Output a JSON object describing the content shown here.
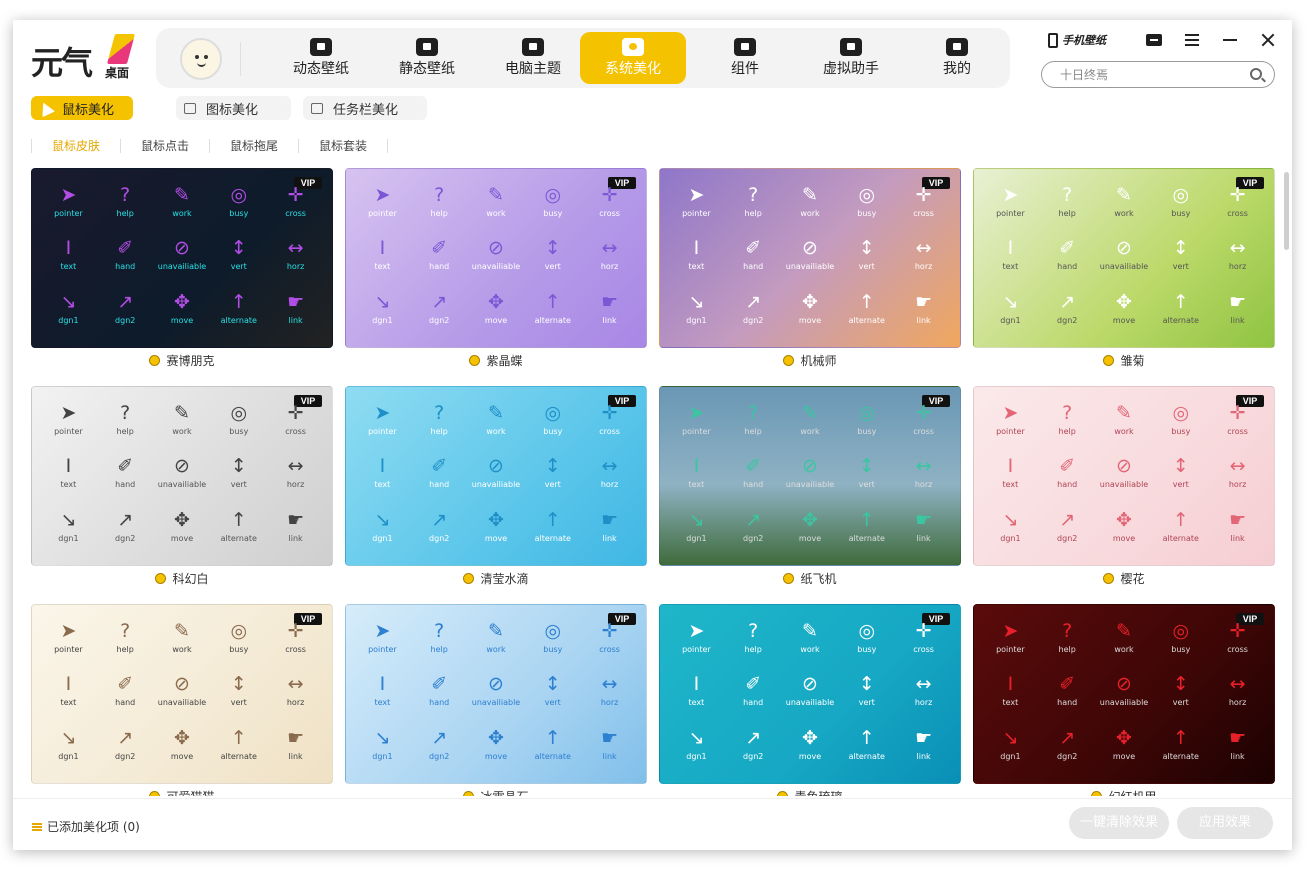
{
  "app": {
    "logo_text": "元气",
    "logo_sub": "桌面"
  },
  "nav": {
    "items": [
      {
        "label": "动态壁纸",
        "icon": "tv-icon"
      },
      {
        "label": "静态壁纸",
        "icon": "picture-icon"
      },
      {
        "label": "电脑主题",
        "icon": "shirt-icon"
      },
      {
        "label": "系统美化",
        "icon": "flower-icon",
        "active": true
      },
      {
        "label": "组件",
        "icon": "widget-icon"
      },
      {
        "label": "虚拟助手",
        "icon": "paw-icon"
      },
      {
        "label": "我的",
        "icon": "face-icon"
      }
    ]
  },
  "header": {
    "phone_wallpaper": "手机壁纸",
    "search_placeholder": "十日终焉"
  },
  "subtabs": [
    {
      "label": "鼠标美化",
      "active": true
    },
    {
      "label": "图标美化"
    },
    {
      "label": "任务栏美化"
    }
  ],
  "filters": [
    {
      "label": "鼠标皮肤",
      "active": true
    },
    {
      "label": "鼠标点击"
    },
    {
      "label": "鼠标拖尾"
    },
    {
      "label": "鼠标套装"
    }
  ],
  "cursor_labels": [
    "pointer",
    "help",
    "work",
    "busy",
    "cross",
    "text",
    "hand",
    "unavailiable",
    "vert",
    "horz",
    "dgn1",
    "dgn2",
    "move",
    "alternate",
    "link"
  ],
  "vip_label": "VIP",
  "cards": [
    {
      "name": "赛博朋克",
      "bg": "linear-gradient(135deg,#1a1a2e,#0d1b2a 60%,#222)",
      "glyph_color": "#b24de6",
      "label_color": "#29e0e6"
    },
    {
      "name": "紫晶蝶",
      "bg": "linear-gradient(135deg,#d7c3f0,#b59ae8 60%,#a887e6)",
      "glyph_color": "#7b57d6",
      "label_color": "#ffffff"
    },
    {
      "name": "机械师",
      "bg": "linear-gradient(135deg,#8e76c9,#c39bc0 50%,#f0a75d)",
      "glyph_color": "#ffffff",
      "label_color": "#ffffff"
    },
    {
      "name": "雏菊",
      "bg": "linear-gradient(135deg,#e9f0d4,#bcd96a 60%,#8fc441)",
      "glyph_color": "#ffffff",
      "label_color": "#555555"
    },
    {
      "name": "科幻白",
      "bg": "linear-gradient(135deg,#f2f2f2,#dcdcdc 60%,#cfcfcf)",
      "glyph_color": "#444444",
      "label_color": "#555555"
    },
    {
      "name": "清莹水滴",
      "bg": "linear-gradient(135deg,#8fdcf2,#5cc6ea 60%,#3fb7e4)",
      "glyph_color": "#1f8fc7",
      "label_color": "#ffffff"
    },
    {
      "name": "纸飞机",
      "bg": "linear-gradient(180deg,#6a97b5,#8fb2c3 55%,#3f6b3b)",
      "glyph_color": "#39c6a0",
      "label_color": "#dddddd"
    },
    {
      "name": "樱花",
      "bg": "linear-gradient(135deg,#fbe9ea,#f8dadd 60%,#f5cdd2)",
      "glyph_color": "#e36676",
      "label_color": "#b04455"
    },
    {
      "name": "可爱猫猫",
      "bg": "linear-gradient(135deg,#fbf6ea,#f4ead5 60%,#efe1c4)",
      "glyph_color": "#8a6b4d",
      "label_color": "#444444"
    },
    {
      "name": "冰霜晶石",
      "bg": "linear-gradient(135deg,#d6ecfa,#a9d4f2 60%,#80bfea)",
      "glyph_color": "#2d7fd0",
      "label_color": "#2d7fd0"
    },
    {
      "name": "青鱼琉璃",
      "bg": "linear-gradient(135deg,#1fb6c9,#16a8c4 60%,#0a8fb6)",
      "glyph_color": "#ffffff",
      "label_color": "#ffffff"
    },
    {
      "name": "幻红机甲",
      "bg": "linear-gradient(135deg,#5a0b0b,#3d0606 60%,#1c0202)",
      "glyph_color": "#e8202a",
      "label_color": "#dddddd"
    }
  ],
  "footer": {
    "added_text": "已添加美化项 (0)",
    "clear_label": "一键清除效果",
    "apply_label": "应用效果"
  }
}
